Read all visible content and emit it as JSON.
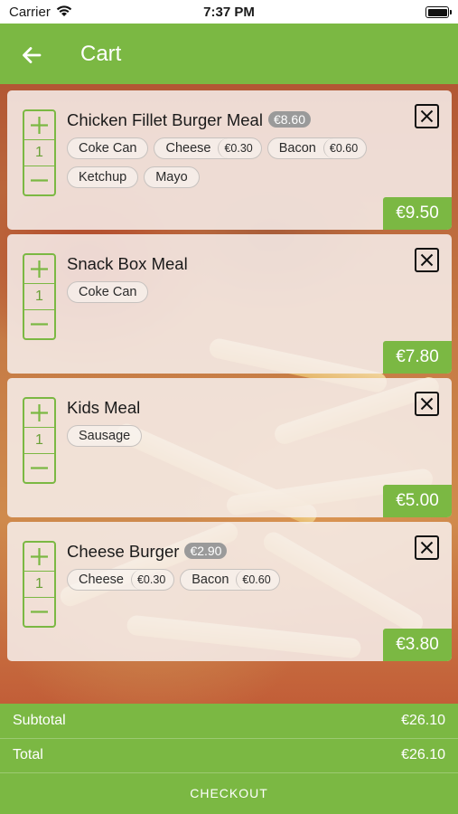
{
  "status_bar": {
    "carrier": "Carrier",
    "time": "7:37 PM"
  },
  "header": {
    "title": "Cart",
    "back_icon": "arrow-left-icon"
  },
  "cart": {
    "items": [
      {
        "name": "Chicken Fillet Burger Meal",
        "base_price": "€8.60",
        "quantity": "1",
        "options": [
          {
            "label": "Coke Can",
            "price": ""
          },
          {
            "label": "Cheese",
            "price": "€0.30"
          },
          {
            "label": "Bacon",
            "price": "€0.60"
          },
          {
            "label": "Ketchup",
            "price": ""
          },
          {
            "label": "Mayo",
            "price": ""
          }
        ],
        "line_total": "€9.50"
      },
      {
        "name": "Snack Box Meal",
        "base_price": "",
        "quantity": "1",
        "options": [
          {
            "label": "Coke Can",
            "price": ""
          }
        ],
        "line_total": "€7.80"
      },
      {
        "name": "Kids Meal",
        "base_price": "",
        "quantity": "1",
        "options": [
          {
            "label": "Sausage",
            "price": ""
          }
        ],
        "line_total": "€5.00"
      },
      {
        "name": "Cheese Burger",
        "base_price": "€2.90",
        "quantity": "1",
        "options": [
          {
            "label": "Cheese",
            "price": "€0.30"
          },
          {
            "label": "Bacon",
            "price": "€0.60"
          }
        ],
        "line_total": "€3.80"
      }
    ]
  },
  "summary": {
    "subtotal_label": "Subtotal",
    "subtotal_value": "€26.10",
    "total_label": "Total",
    "total_value": "€26.10",
    "checkout_label": "CHECKOUT"
  },
  "colors": {
    "accent": "#7bb843",
    "chip_price_pill": "#9a9a9a"
  }
}
